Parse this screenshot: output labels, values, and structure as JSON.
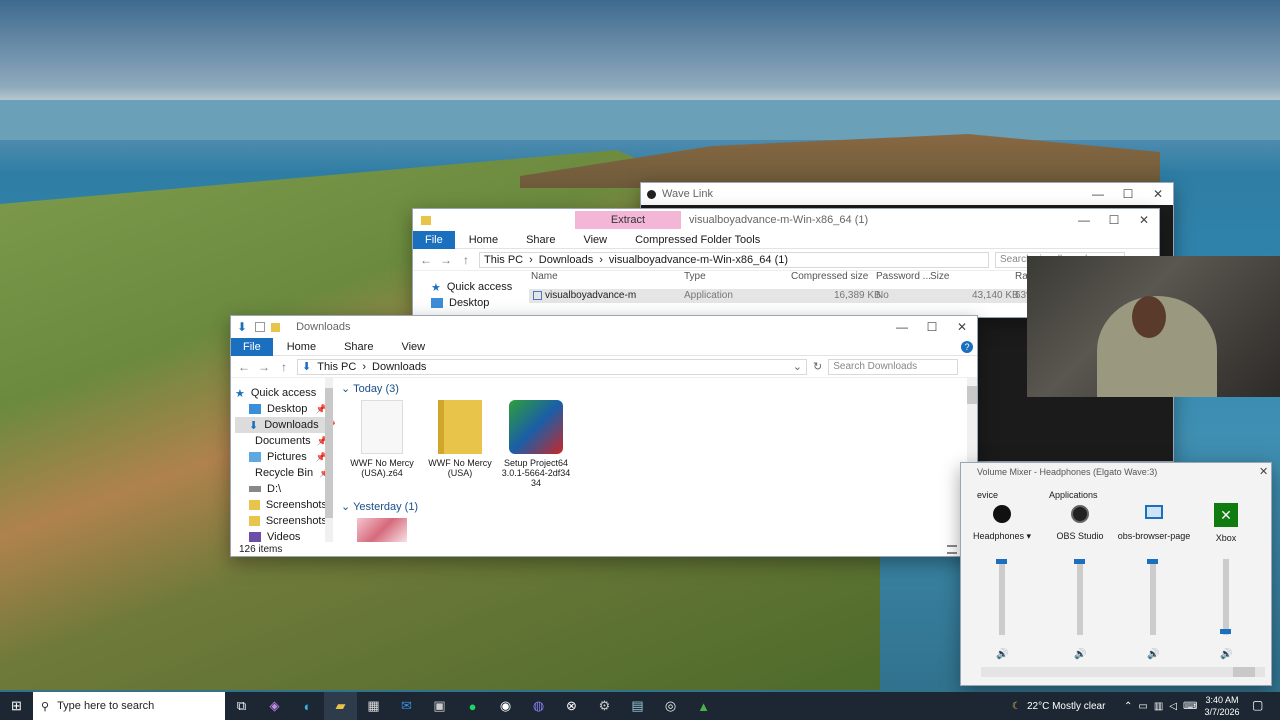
{
  "wave_link": {
    "title": "Wave Link"
  },
  "zip_window": {
    "context_tab": "Extract",
    "title": "visualboyadvance-m-Win-x86_64 (1)",
    "ribbon": [
      "Home",
      "Share",
      "View",
      "Compressed Folder Tools"
    ],
    "file_tab": "File",
    "breadcrumb": [
      "This PC",
      "Downloads",
      "visualboyadvance-m-Win-x86_64 (1)"
    ],
    "search_placeholder": "Search visualboyadvance-m...",
    "columns": [
      "Name",
      "Type",
      "Compressed size",
      "Password ...",
      "Size",
      "Ratio"
    ],
    "row": {
      "name": "visualboyadvance-m",
      "type": "Application",
      "compressed": "16,389 KB",
      "password": "No",
      "size": "43,140 KB",
      "ratio": "63%"
    },
    "sidebar": [
      "Quick access",
      "Desktop"
    ]
  },
  "downloads_window": {
    "title": "Downloads",
    "file_tab": "File",
    "ribbon": [
      "Home",
      "Share",
      "View"
    ],
    "breadcrumb": [
      "This PC",
      "Downloads"
    ],
    "search_placeholder": "Search Downloads",
    "sidebar": [
      "Quick access",
      "Desktop",
      "Downloads",
      "Documents",
      "Pictures",
      "Recycle Bin",
      "D:\\",
      "Screenshots",
      "Screenshots",
      "Videos"
    ],
    "groups": {
      "today": "Today (3)",
      "yesterday": "Yesterday (1)"
    },
    "files": [
      {
        "line1": "WWF No Mercy",
        "line2": "(USA).z64",
        "line3": ""
      },
      {
        "line1": "WWF No Mercy",
        "line2": "(USA)",
        "line3": ""
      },
      {
        "line1": "Setup Project64",
        "line2": "3.0.1-5664-2df34",
        "line3": "34"
      }
    ],
    "status": "126 items"
  },
  "mixer": {
    "title": "Volume Mixer - Headphones (Elgato Wave:3)",
    "device_label": "evice",
    "apps_label": "Applications",
    "device": "Headphones",
    "apps": [
      "OBS Studio",
      "obs-browser-page",
      "Xbox"
    ],
    "levels": [
      1.0,
      1.0,
      1.0,
      0.02
    ]
  },
  "taskbar": {
    "search_placeholder": "Type here to search",
    "weather": "22°C  Mostly clear",
    "time": "3:40 AM",
    "date": "3/7/2026"
  },
  "colors": {
    "accent": "#1a6fbf",
    "extract_tab": "#f4b6d6",
    "taskbar": "#1c2733"
  }
}
